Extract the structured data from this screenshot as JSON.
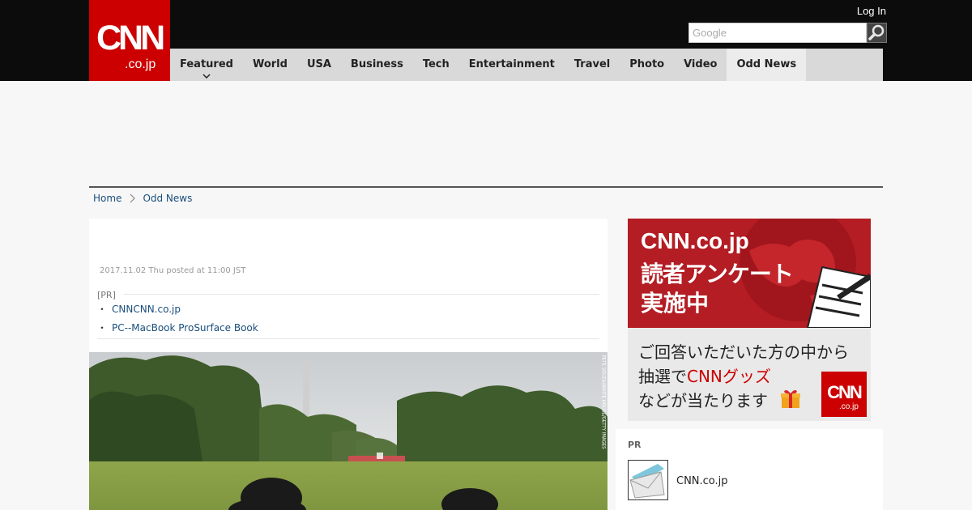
{
  "header": {
    "logo": {
      "main": "CNN",
      "sub": ".co.jp"
    },
    "login_label": "Log In",
    "search": {
      "placeholder": "Google"
    }
  },
  "nav": {
    "items": [
      {
        "label": "Featured"
      },
      {
        "label": "World"
      },
      {
        "label": "USA"
      },
      {
        "label": "Business"
      },
      {
        "label": "Tech"
      },
      {
        "label": "Entertainment"
      },
      {
        "label": "Travel"
      },
      {
        "label": "Photo"
      },
      {
        "label": "Video"
      },
      {
        "label": "Odd News"
      }
    ],
    "active": "Odd News"
  },
  "breadcrumb": {
    "home": "Home",
    "current": "Odd News"
  },
  "article": {
    "date": "2017.11.02 Thu posted at 11:00 JST",
    "pr_label": "[PR]",
    "links": [
      {
        "text": "CNNCNN.co.jp"
      },
      {
        "text": "PC--MacBook ProSurface Book"
      }
    ],
    "photo_credit": "PETE SOUZA/WHITE HOUSE/GETTY IMAGES"
  },
  "sidebar": {
    "banner": {
      "title": "CNN.co.jp",
      "line2": "読者アンケート",
      "line3": "実施中",
      "body_line1": "ご回答いただいた方の中から",
      "body_line2_prefix": "抽選で",
      "body_line2_highlight": "CNNグッズ",
      "body_line3": "などが当たります",
      "logo_main": "CNN",
      "logo_sub": ".co.jp"
    },
    "pr": {
      "label": "PR",
      "item_text": "CNN.co.jp"
    }
  },
  "colors": {
    "brand_red": "#cc0000",
    "header_bg": "#0c0c0c",
    "nav_bg": "#d9d9d9",
    "link": "#1a4e7c"
  }
}
